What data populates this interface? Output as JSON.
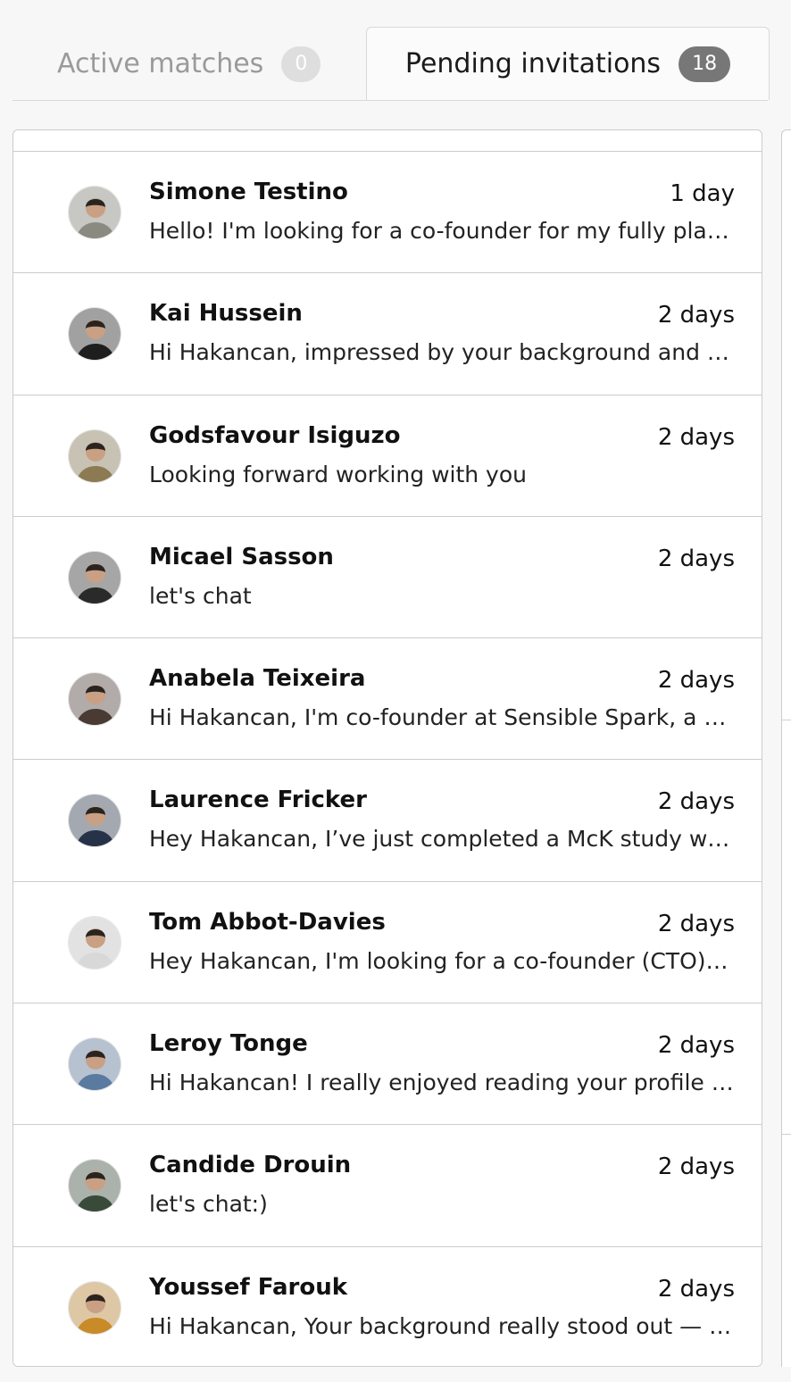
{
  "tabs": {
    "active": {
      "label": "Active matches",
      "count": "0"
    },
    "pending": {
      "label": "Pending invitations",
      "count": "18"
    }
  },
  "invitations": [
    {
      "name": "Simone Testino",
      "time": "1 day",
      "message": "Hello! I'm looking for a co-founder for my fully planned startup",
      "avatar_color": "#8a8a80"
    },
    {
      "name": "Kai Hussein",
      "time": "2 days",
      "message": "Hi Hakancan, impressed by your background and would love to connect",
      "avatar_color": "#1e1e1e"
    },
    {
      "name": "Godsfavour Isiguzo",
      "time": "2 days",
      "message": "Looking forward working with you",
      "avatar_color": "#8c7a52"
    },
    {
      "name": "Micael Sasson",
      "time": "2 days",
      "message": "let's chat",
      "avatar_color": "#2a2a2a"
    },
    {
      "name": "Anabela Teixeira",
      "time": "2 days",
      "message": "Hi Hakancan, I'm co-founder at Sensible Spark, a startup building",
      "avatar_color": "#4a3a34"
    },
    {
      "name": "Laurence Fricker",
      "time": "2 days",
      "message": "Hey Hakancan, I’ve just completed a McK study which inspired me",
      "avatar_color": "#263248"
    },
    {
      "name": "Tom Abbot-Davies",
      "time": "2 days",
      "message": "Hey Hakancan, I'm looking for a co-founder (CTO) to build with",
      "avatar_color": "#d8d8d8"
    },
    {
      "name": "Leroy Tonge",
      "time": "2 days",
      "message": "Hi Hakancan! I really enjoyed reading your profile and background",
      "avatar_color": "#5a7aa0"
    },
    {
      "name": "Candide Drouin",
      "time": "2 days",
      "message": "let's chat:)",
      "avatar_color": "#3a4a3a"
    },
    {
      "name": "Youssef Farouk",
      "time": "2 days",
      "message": "Hi Hakancan, Your background really stood out — I'd love to talk",
      "avatar_color": "#c98a28"
    }
  ]
}
